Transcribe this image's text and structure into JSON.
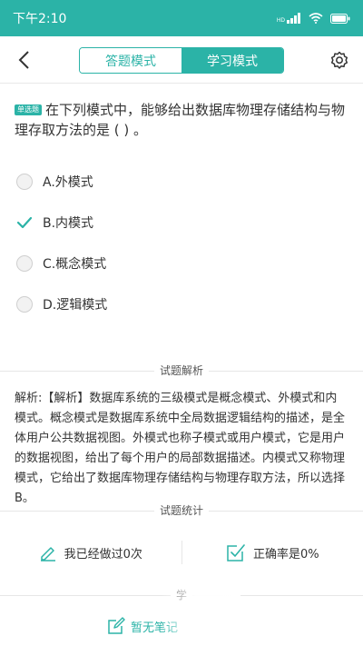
{
  "status_bar": {
    "time": "下午2:10",
    "signal_label": "HD",
    "colors": {
      "background": "#2bb3a7",
      "text": "#ffffff"
    }
  },
  "header": {
    "back_icon": "chevron-left-icon",
    "modes": [
      {
        "label": "答题模式",
        "active": false
      },
      {
        "label": "学习模式",
        "active": true
      }
    ],
    "settings_icon": "gear-icon"
  },
  "question": {
    "type_badge": "单选题",
    "text": "在下列模式中，能够给出数据库物理存储结构与物理存取方法的是 (   ) 。",
    "options": [
      {
        "label": "A.外模式",
        "checked": false
      },
      {
        "label": "B.内模式",
        "checked": true
      },
      {
        "label": "C.概念模式",
        "checked": false
      },
      {
        "label": "D.逻辑模式",
        "checked": false
      }
    ]
  },
  "analysis": {
    "title": "试题解析",
    "text": "解析:【解析】数据库系统的三级模式是概念模式、外模式和内模式。概念模式是数据库系统中全局数据逻辑结构的描述，是全体用户公共数据视图。外模式也称子模式或用户模式，它是用户的数据视图，给出了每个用户的局部数据描述。内模式又称物理模式，它给出了数据库物理存储结构与物理存取方法，所以选择B。"
  },
  "stats": {
    "title": "试题统计",
    "done_text": "我已经做过0次",
    "accuracy_text": "正确率是0%"
  },
  "notes": {
    "title_partial": "学",
    "empty_text": "暂无笔记"
  },
  "accent_color": "#2bb3a7"
}
